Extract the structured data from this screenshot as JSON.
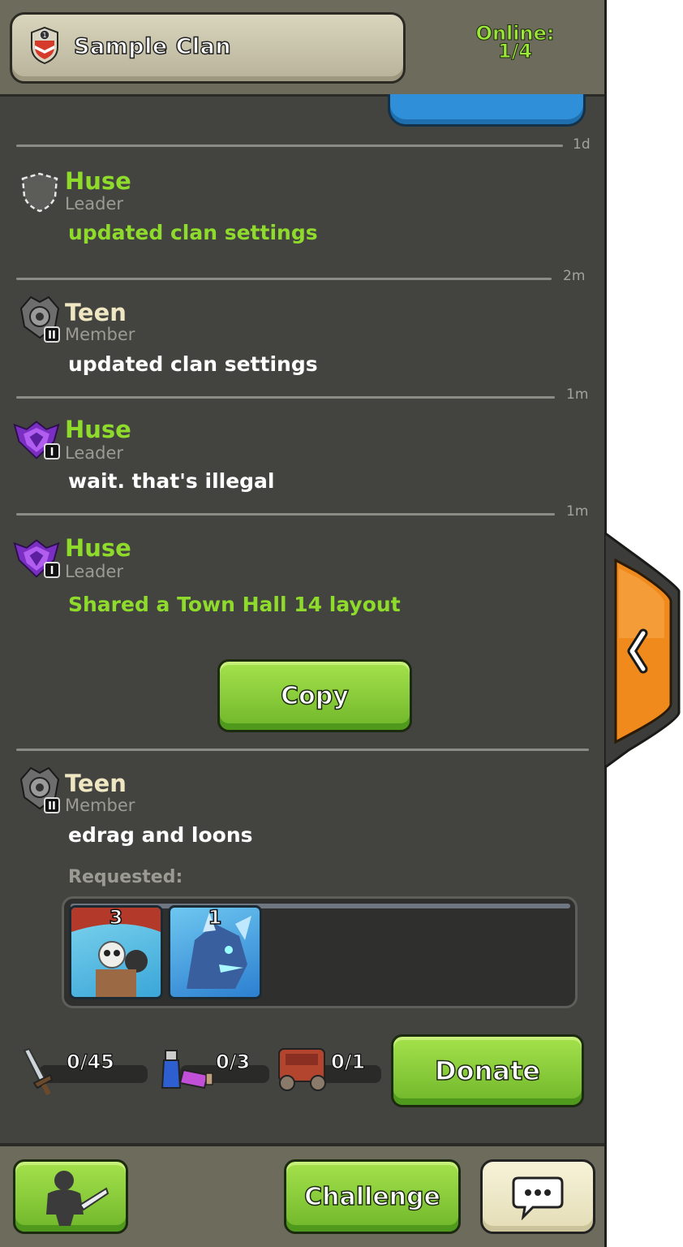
{
  "header": {
    "clan_name": "Sample Clan",
    "clan_badge_level": "1",
    "online_label": "Online:",
    "online_count": "1/4"
  },
  "messages": [
    {
      "time": "1d",
      "username": "Huse",
      "role": "Leader",
      "text": "updated clan settings"
    },
    {
      "time": "2m",
      "username": "Teen",
      "role": "Member",
      "text": "updated clan settings",
      "level": "II"
    },
    {
      "time": "1m",
      "username": "Huse",
      "role": "Leader",
      "text": "wait. that's illegal",
      "level": "I"
    },
    {
      "time": "1m",
      "username": "Huse",
      "role": "Leader",
      "text": "Shared a Town Hall 14 layout",
      "level": "I",
      "button": "Copy"
    },
    {
      "username": "Teen",
      "role": "Member",
      "text": "edrag and loons",
      "level": "II"
    }
  ],
  "request": {
    "label": "Requested:",
    "troops": [
      {
        "name": "balloon-card",
        "count": "3"
      },
      {
        "name": "electro-dragon-card",
        "count": "1"
      }
    ],
    "troop_capacity": "0/45",
    "spell_capacity": "0/3",
    "siege_capacity": "0/1",
    "donate_label": "Donate"
  },
  "footer": {
    "challenge_label": "Challenge",
    "chat_icon": "speech-bubble-icon",
    "war_icon": "barbarian-sword-icon"
  },
  "side_tab": {
    "icon": "chevron-left-icon"
  },
  "colors": {
    "panel": "#434340",
    "header": "#6d6b5c",
    "green_name": "#8fdb2c",
    "member_name": "#efe6c2",
    "button_green": "#7cc232",
    "side_tab_orange": "#f08a1c"
  }
}
